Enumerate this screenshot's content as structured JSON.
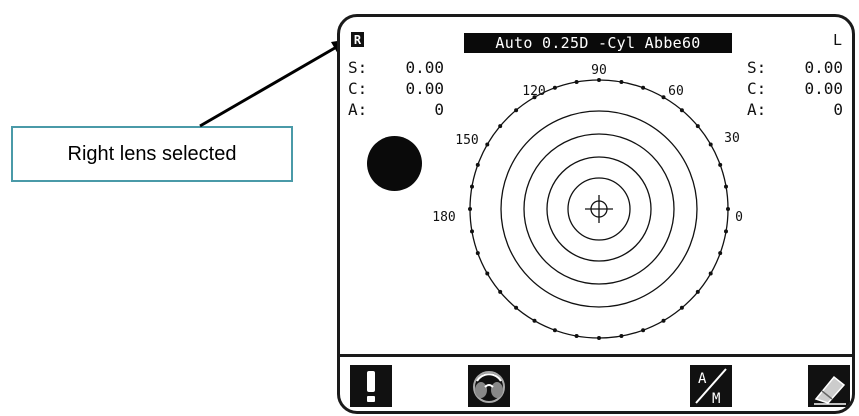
{
  "callout": {
    "text": "Right lens selected"
  },
  "screen": {
    "right_lens_indicator": "R",
    "left_lens_indicator": "L",
    "mode_bar": "Auto 0.25D -Cyl Abbe60",
    "left_values": [
      {
        "label": "S:",
        "value": "0.00"
      },
      {
        "label": "C:",
        "value": "0.00"
      },
      {
        "label": "A:",
        "value": "0"
      }
    ],
    "right_values": [
      {
        "label": "S:",
        "value": "0.00"
      },
      {
        "label": "C:",
        "value": "0.00"
      },
      {
        "label": "A:",
        "value": "0"
      }
    ],
    "dial_labels": {
      "deg_90": "90",
      "deg_120": "120",
      "deg_60": "60",
      "deg_150": "150",
      "deg_30": "30",
      "deg_180": "180",
      "deg_0": "0"
    },
    "toolbar": {
      "warning_icon": "exclamation-icon",
      "lens_icon": "lens-holder-icon",
      "am_icon_top": "A",
      "am_icon_bottom": "M",
      "print_icon": "eraser-icon"
    }
  },
  "colors": {
    "screen_ink": "#111111",
    "screen_bg": "#ffffff",
    "callout_border": "#4a9aa8"
  }
}
